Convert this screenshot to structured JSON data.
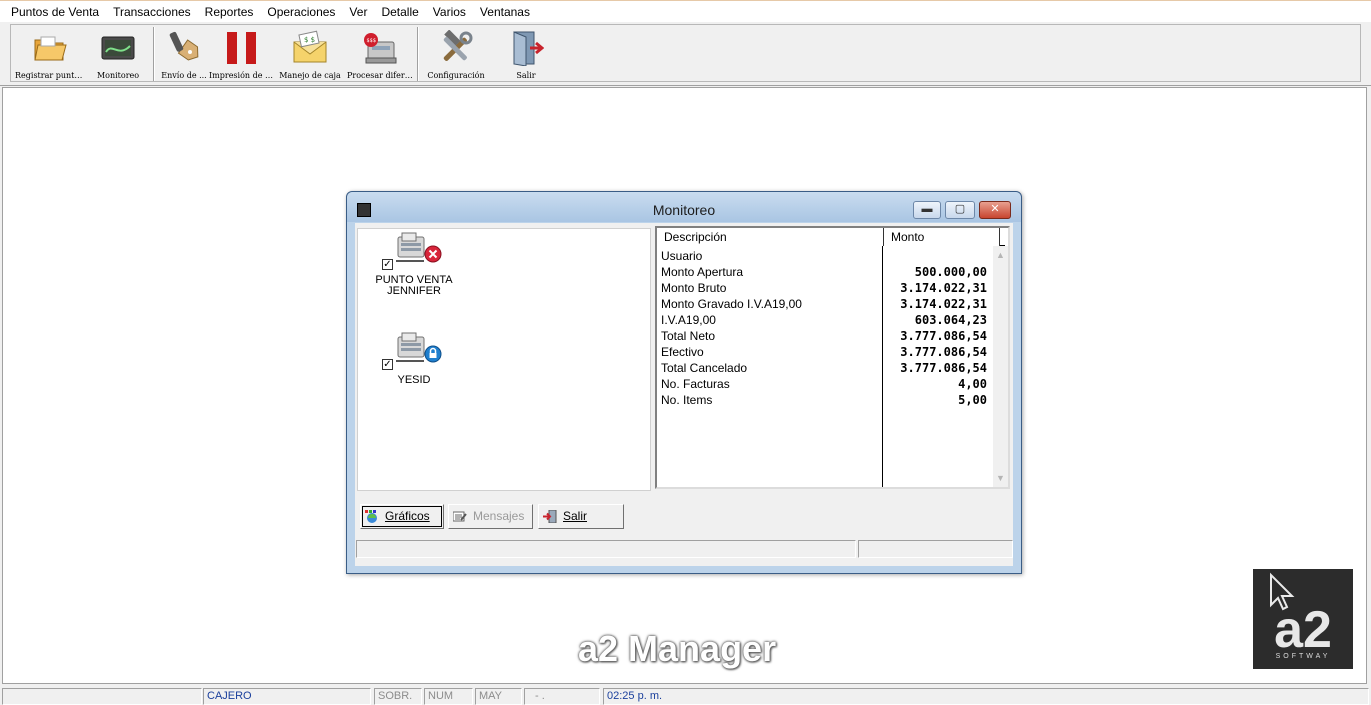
{
  "menu": [
    "Puntos de Venta",
    "Transacciones",
    "Reportes",
    "Operaciones",
    "Ver",
    "Detalle",
    "Varios",
    "Ventanas"
  ],
  "toolbar": {
    "buttons": [
      {
        "label": "Registrar punto...",
        "icon": "folder-icon"
      },
      {
        "label": "Monitoreo",
        "icon": "monitor-icon"
      },
      {
        "label": "Envío de ...",
        "icon": "price-tag-icon"
      },
      {
        "label": "Impresión de et...",
        "icon": "red-bars-icon"
      },
      {
        "label": "Manejo de caja",
        "icon": "envelope-money-icon"
      },
      {
        "label": "Procesar diferi...",
        "icon": "cash-register-icon"
      },
      {
        "label": "Configuración",
        "icon": "tools-icon"
      },
      {
        "label": "Salir",
        "icon": "exit-door-icon"
      }
    ]
  },
  "dialog": {
    "title": "Monitoreo",
    "window_buttons": {
      "minimize": "▬",
      "maximize": "▢",
      "close": "✕"
    },
    "puntos_venta": [
      {
        "name": "PUNTO VENTA\nJENNIFER",
        "status_icon": "error-x-icon",
        "checked": true
      },
      {
        "name": "YESID",
        "status_icon": "lock-icon",
        "checked": true
      }
    ],
    "table": {
      "headers": {
        "descripcion": "Descripción",
        "monto": "Monto"
      },
      "rows": [
        {
          "desc": "Usuario",
          "monto": ""
        },
        {
          "desc": "Monto Apertura",
          "monto": "500.000,00"
        },
        {
          "desc": "Monto Bruto",
          "monto": "3.174.022,31"
        },
        {
          "desc": "Monto Gravado I.V.A19,00",
          "monto": "3.174.022,31"
        },
        {
          "desc": "I.V.A19,00",
          "monto": "603.064,23"
        },
        {
          "desc": "Total Neto",
          "monto": "3.777.086,54"
        },
        {
          "desc": "Efectivo",
          "monto": "3.777.086,54"
        },
        {
          "desc": "Total Cancelado",
          "monto": "3.777.086,54"
        },
        {
          "desc": "No. Facturas",
          "monto": "4,00"
        },
        {
          "desc": "No. Items",
          "monto": "5,00"
        }
      ]
    },
    "buttons": {
      "graficos": "Gráficos",
      "mensajes": "Mensajes",
      "salir": "Salir"
    }
  },
  "watermark": "a2 Manager",
  "logo": {
    "text": "SOFTWAY",
    "mark": "a2"
  },
  "statusbar": {
    "cajero": "CAJERO",
    "sobr": "SOBR.",
    "num": "NUM",
    "may": "MAY",
    "sep": "- .",
    "time": "02:25 p. m."
  }
}
